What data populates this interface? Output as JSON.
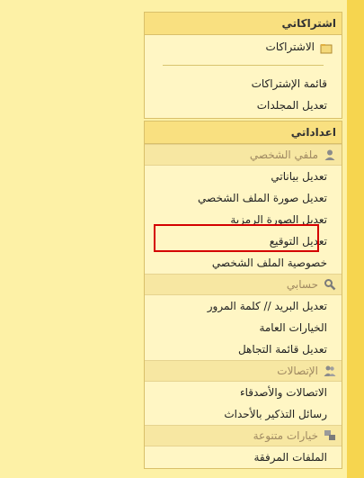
{
  "subscriptions": {
    "header": "اشتراكاتي",
    "items": [
      {
        "label": "الاشتراكات",
        "icon": "folder-icon"
      },
      {
        "label": "قائمة الإشتراكات"
      },
      {
        "label": "تعديل المجلدات"
      }
    ]
  },
  "settings": {
    "header": "اعداداتي",
    "profile": {
      "title": "ملفي الشخصي",
      "icon": "user-icon",
      "items": [
        "تعديل بياناتي",
        "تعديل صورة الملف الشخصي",
        "تعديل الصورة الرمزية",
        "تعديل التوقيع",
        "خصوصية الملف الشخصي"
      ]
    },
    "account": {
      "title": "حسابي",
      "icon": "magnifier-icon",
      "items": [
        "تعديل البريد // كلمة المرور",
        "الخيارات العامة",
        "تعديل قائمة التجاهل"
      ]
    },
    "contacts": {
      "title": "الإتصالات",
      "icon": "users-icon",
      "items": [
        "الاتصالات والأصدقاء",
        "رسائل التذكير بالأحداث"
      ]
    },
    "misc": {
      "title": "خيارات متنوعة",
      "icon": "misc-icon",
      "items": [
        "الملفات المرفقة"
      ]
    }
  },
  "colors": {
    "background": "#fdf1a6",
    "panel": "#fff6c4",
    "header": "#f9e080",
    "highlight_border": "#d40000",
    "right_bar": "#f6d54f"
  }
}
